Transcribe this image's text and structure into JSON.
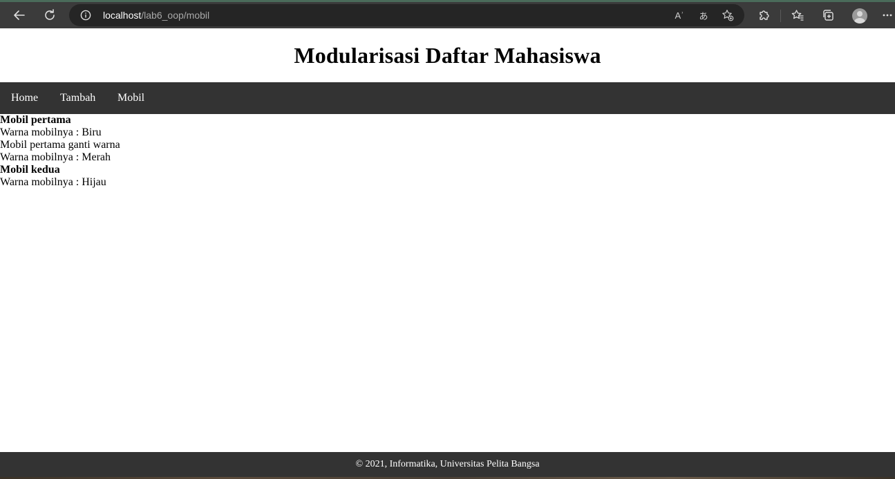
{
  "browser": {
    "url_host": "localhost",
    "url_path": "/lab6_oop/mobil",
    "read_aloud_glyph": "Aʾ",
    "translate_glyph": "あ"
  },
  "page": {
    "title": "Modularisasi Daftar Mahasiswa",
    "nav": [
      "Home",
      "Tambah",
      "Mobil"
    ],
    "lines": [
      "Mobil pertama",
      "Warna mobilnya : Biru",
      "Mobil pertama ganti warna",
      "Warna mobilnya : Merah",
      "Mobil kedua",
      "Warna mobilnya : Hijau"
    ],
    "footer": "© 2021, Informatika, Universitas Pelita Bangsa"
  }
}
